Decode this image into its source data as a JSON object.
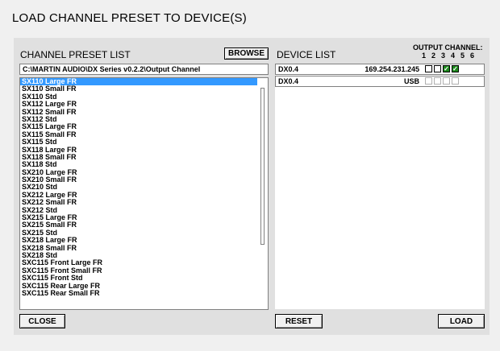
{
  "dialog": {
    "title": "LOAD CHANNEL PRESET TO DEVICE(S)"
  },
  "preset_list": {
    "label": "CHANNEL PRESET LIST",
    "browse_label": "BROWSE",
    "path": "C:\\MARTIN AUDIO\\DX Series v0.2.2\\Output Channel",
    "selected": "SX110 Large FR",
    "items": [
      "SX110 Large FR",
      "SX110 Small FR",
      "SX110 Std",
      "SX112  Large FR",
      "SX112  Small FR",
      "SX112 Std",
      "SX115 Large FR",
      "SX115 Small FR",
      "SX115 Std",
      "SX118 Large FR",
      "SX118 Small FR",
      "SX118 Std",
      "SX210 Large FR",
      "SX210 Small FR",
      "SX210 Std",
      "SX212 Large FR",
      "SX212 Small FR",
      "SX212 Std",
      "SX215 Large FR",
      "SX215 Small FR",
      "SX215 Std",
      "SX218 Large FR",
      "SX218 Small FR",
      "SX218 Std",
      "SXC115 Front Large FR",
      "SXC115 Front Small FR",
      "SXC115 Front Std",
      "SXC115 Rear Large FR",
      "SXC115 Rear Small FR"
    ]
  },
  "device_list": {
    "label": "DEVICE LIST",
    "output_header": "OUTPUT CHANNEL:",
    "channel_numbers": [
      "1",
      "2",
      "3",
      "4",
      "5",
      "6"
    ],
    "devices": [
      {
        "name": "DX0.4",
        "address": "169.254.231.245",
        "channels": [
          "unchecked",
          "unchecked",
          "checked",
          "checked"
        ]
      },
      {
        "name": "DX0.4",
        "address": "USB",
        "channels": [
          "disabled",
          "disabled",
          "disabled",
          "disabled"
        ]
      }
    ]
  },
  "buttons": {
    "close": "CLOSE",
    "reset": "RESET",
    "load": "LOAD"
  },
  "colors": {
    "selection": "#3399ff",
    "checked": "#1e8a1e"
  }
}
